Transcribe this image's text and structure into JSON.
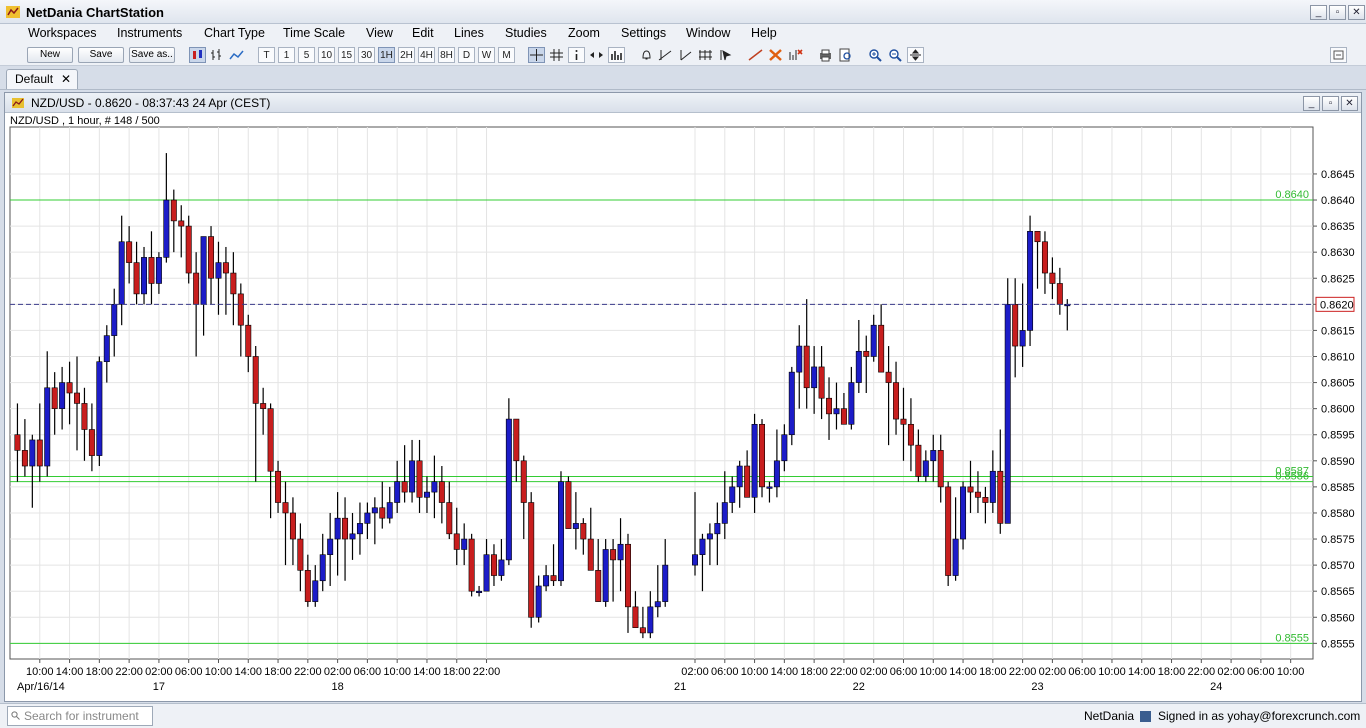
{
  "app": {
    "title": "NetDania ChartStation",
    "window_buttons": [
      "_",
      "▫",
      "✕"
    ]
  },
  "menu": [
    "Workspaces",
    "Instruments",
    "Chart Type",
    "Time Scale",
    "View",
    "Edit",
    "Lines",
    "Studies",
    "Zoom",
    "Settings",
    "Window",
    "Help"
  ],
  "toolbar": {
    "new_label": "New",
    "save_label": "Save",
    "save_as_label": "Save as..",
    "timeframes": [
      "T",
      "1",
      "5",
      "10",
      "15",
      "30",
      "1H",
      "2H",
      "4H",
      "8H",
      "D",
      "W",
      "M"
    ],
    "active_timeframe": "1H"
  },
  "workspace_tab": {
    "label": "Default",
    "close": "✕"
  },
  "chart_window": {
    "title": "NZD/USD - 0.8620 - 08:37:43  24 Apr (CEST)",
    "buttons": [
      "_",
      "▫",
      "✕"
    ]
  },
  "chart_data": {
    "type": "candlestick",
    "title": "NZD/USD , 1 hour, # 148 / 500",
    "ylim": [
      0.8552,
      0.8654
    ],
    "y_ticks": [
      "0.8555",
      "0.8560",
      "0.8565",
      "0.8570",
      "0.8575",
      "0.8580",
      "0.8585",
      "0.8590",
      "0.8595",
      "0.8600",
      "0.8605",
      "0.8610",
      "0.8615",
      "0.8620",
      "0.8625",
      "0.8630",
      "0.8635",
      "0.8640",
      "0.8645"
    ],
    "x_tick_labels": [
      "10:00",
      "14:00",
      "18:00",
      "22:00",
      "02:00",
      "06:00",
      "10:00",
      "14:00",
      "18:00",
      "22:00",
      "02:00",
      "06:00",
      "10:00",
      "14:00",
      "18:00",
      "22:00",
      "02:00",
      "06:00",
      "10:00",
      "14:00",
      "18:00",
      "22:00",
      "02:00",
      "06:00",
      "10:00",
      "14:00",
      "18:00",
      "22:00",
      "02:00",
      "06:00",
      "10:00",
      "14:00",
      "18:00",
      "22:00",
      "02:00",
      "06:00",
      "10:00"
    ],
    "x_tick_hours": [
      10,
      14,
      18,
      22,
      26,
      30,
      34,
      38,
      42,
      46,
      50,
      54,
      58,
      62,
      66,
      70,
      98,
      102,
      106,
      110,
      114,
      118,
      122,
      126,
      130,
      134,
      138,
      142,
      146,
      150,
      154,
      158,
      162,
      166,
      170,
      174,
      178
    ],
    "date_labels": [
      {
        "label": "Apr/16/14",
        "hour": 10
      },
      {
        "label": "17",
        "hour": 26
      },
      {
        "label": "18",
        "hour": 50
      },
      {
        "label": "21",
        "hour": 96
      },
      {
        "label": "22",
        "hour": 120
      },
      {
        "label": "23",
        "hour": 144
      },
      {
        "label": "24",
        "hour": 168
      }
    ],
    "x_range_hours": [
      6,
      181
    ],
    "current_price": 0.862,
    "current_price_label": "0.8620",
    "horizontal_lines": [
      {
        "value": 0.864,
        "label": "0.8640"
      },
      {
        "value": 0.8587,
        "label": "0.8587"
      },
      {
        "value": 0.8586,
        "label": "0.8586"
      },
      {
        "value": 0.8555,
        "label": "0.8555"
      }
    ],
    "colors": {
      "up": "#1c1cc8",
      "down": "#c81e1e",
      "hline": "#33cc33",
      "price_line": "#3a3a8a",
      "price_box": "#cc2020"
    },
    "ohlc": [
      [
        7,
        0.8595,
        0.8601,
        0.8586,
        0.8592
      ],
      [
        8,
        0.8592,
        0.8598,
        0.8587,
        0.8589
      ],
      [
        9,
        0.8589,
        0.8595,
        0.8581,
        0.8594
      ],
      [
        10,
        0.8594,
        0.8601,
        0.8586,
        0.8589
      ],
      [
        11,
        0.8589,
        0.8611,
        0.8587,
        0.8604
      ],
      [
        12,
        0.8604,
        0.8607,
        0.8595,
        0.86
      ],
      [
        13,
        0.86,
        0.8608,
        0.8596,
        0.8605
      ],
      [
        14,
        0.8605,
        0.8609,
        0.8597,
        0.8603
      ],
      [
        15,
        0.8603,
        0.861,
        0.8592,
        0.8601
      ],
      [
        16,
        0.8601,
        0.8604,
        0.859,
        0.8596
      ],
      [
        17,
        0.8596,
        0.8601,
        0.8588,
        0.8591
      ],
      [
        18,
        0.8591,
        0.861,
        0.8589,
        0.8609
      ],
      [
        19,
        0.8609,
        0.8616,
        0.8605,
        0.8614
      ],
      [
        20,
        0.8614,
        0.8623,
        0.861,
        0.862
      ],
      [
        21,
        0.862,
        0.8637,
        0.8616,
        0.8632
      ],
      [
        22,
        0.8632,
        0.8635,
        0.8624,
        0.8628
      ],
      [
        23,
        0.8628,
        0.8632,
        0.862,
        0.8622
      ],
      [
        24,
        0.8622,
        0.8631,
        0.862,
        0.8629
      ],
      [
        25,
        0.8629,
        0.8634,
        0.862,
        0.8624
      ],
      [
        26,
        0.8624,
        0.863,
        0.8622,
        0.8629
      ],
      [
        27,
        0.8629,
        0.8649,
        0.8628,
        0.864
      ],
      [
        28,
        0.864,
        0.8642,
        0.863,
        0.8636
      ],
      [
        29,
        0.8636,
        0.8639,
        0.8629,
        0.8635
      ],
      [
        30,
        0.8635,
        0.8637,
        0.8624,
        0.8626
      ],
      [
        31,
        0.8626,
        0.863,
        0.861,
        0.862
      ],
      [
        32,
        0.862,
        0.8633,
        0.8614,
        0.8633
      ],
      [
        33,
        0.8633,
        0.8635,
        0.862,
        0.8625
      ],
      [
        34,
        0.8625,
        0.8632,
        0.8618,
        0.8628
      ],
      [
        35,
        0.8628,
        0.8631,
        0.8618,
        0.8626
      ],
      [
        36,
        0.8626,
        0.863,
        0.8616,
        0.8622
      ],
      [
        37,
        0.8622,
        0.8624,
        0.861,
        0.8616
      ],
      [
        38,
        0.8616,
        0.8618,
        0.8607,
        0.861
      ],
      [
        39,
        0.861,
        0.8612,
        0.8586,
        0.8601
      ],
      [
        40,
        0.8601,
        0.8604,
        0.8595,
        0.86
      ],
      [
        41,
        0.86,
        0.8601,
        0.8579,
        0.8588
      ],
      [
        42,
        0.8588,
        0.859,
        0.858,
        0.8582
      ],
      [
        43,
        0.8582,
        0.8586,
        0.857,
        0.858
      ],
      [
        44,
        0.858,
        0.8583,
        0.857,
        0.8575
      ],
      [
        45,
        0.8575,
        0.8578,
        0.8565,
        0.8569
      ],
      [
        46,
        0.8569,
        0.8572,
        0.8562,
        0.8563
      ],
      [
        47,
        0.8563,
        0.857,
        0.8562,
        0.8567
      ],
      [
        48,
        0.8567,
        0.8576,
        0.8565,
        0.8572
      ],
      [
        49,
        0.8572,
        0.858,
        0.8566,
        0.8575
      ],
      [
        50,
        0.8575,
        0.8584,
        0.8568,
        0.8579
      ],
      [
        51,
        0.8579,
        0.8583,
        0.8567,
        0.8575
      ],
      [
        52,
        0.8575,
        0.858,
        0.8571,
        0.8576
      ],
      [
        53,
        0.8576,
        0.8582,
        0.8572,
        0.8578
      ],
      [
        54,
        0.8578,
        0.8582,
        0.8575,
        0.858
      ],
      [
        55,
        0.858,
        0.8583,
        0.8574,
        0.8581
      ],
      [
        56,
        0.8581,
        0.8586,
        0.8577,
        0.8579
      ],
      [
        57,
        0.8579,
        0.8585,
        0.8578,
        0.8582
      ],
      [
        58,
        0.8582,
        0.859,
        0.858,
        0.8586
      ],
      [
        59,
        0.8586,
        0.8593,
        0.8582,
        0.8584
      ],
      [
        60,
        0.8584,
        0.8594,
        0.8582,
        0.859
      ],
      [
        61,
        0.859,
        0.8594,
        0.858,
        0.8583
      ],
      [
        62,
        0.8583,
        0.8587,
        0.858,
        0.8584
      ],
      [
        63,
        0.8584,
        0.8591,
        0.8579,
        0.8586
      ],
      [
        64,
        0.8586,
        0.8589,
        0.8578,
        0.8582
      ],
      [
        65,
        0.8582,
        0.8586,
        0.8575,
        0.8576
      ],
      [
        66,
        0.8576,
        0.8581,
        0.857,
        0.8573
      ],
      [
        67,
        0.8573,
        0.8578,
        0.857,
        0.8575
      ],
      [
        68,
        0.8575,
        0.8576,
        0.8564,
        0.8565
      ],
      [
        69,
        0.8565,
        0.8566,
        0.8564,
        0.8565
      ],
      [
        70,
        0.8565,
        0.8575,
        0.8568,
        0.8572
      ],
      [
        71,
        0.8572,
        0.8574,
        0.8566,
        0.8568
      ],
      [
        72,
        0.8568,
        0.8575,
        0.8567,
        0.8571
      ],
      [
        73,
        0.8571,
        0.8602,
        0.857,
        0.8598
      ],
      [
        74,
        0.8598,
        0.8598,
        0.8586,
        0.859
      ],
      [
        75,
        0.859,
        0.8591,
        0.8575,
        0.8582
      ],
      [
        76,
        0.8582,
        0.8584,
        0.8558,
        0.856
      ],
      [
        77,
        0.856,
        0.8568,
        0.8559,
        0.8566
      ],
      [
        78,
        0.8566,
        0.857,
        0.8565,
        0.8568
      ],
      [
        79,
        0.8568,
        0.8574,
        0.8566,
        0.8567
      ],
      [
        80,
        0.8567,
        0.8588,
        0.8566,
        0.8586
      ],
      [
        81,
        0.8586,
        0.8587,
        0.8577,
        0.8577
      ],
      [
        82,
        0.8577,
        0.8584,
        0.8573,
        0.8578
      ],
      [
        83,
        0.8578,
        0.8579,
        0.8572,
        0.8575
      ],
      [
        84,
        0.8575,
        0.8581,
        0.857,
        0.8569
      ],
      [
        85,
        0.8569,
        0.8575,
        0.8563,
        0.8563
      ],
      [
        86,
        0.8563,
        0.8575,
        0.8562,
        0.8573
      ],
      [
        87,
        0.8573,
        0.8575,
        0.8563,
        0.8571
      ],
      [
        88,
        0.8571,
        0.8579,
        0.8565,
        0.8574
      ],
      [
        89,
        0.8574,
        0.8576,
        0.8557,
        0.8562
      ],
      [
        90,
        0.8562,
        0.8565,
        0.8558,
        0.8558
      ],
      [
        91,
        0.8558,
        0.8562,
        0.8556,
        0.8557
      ],
      [
        92,
        0.8557,
        0.8565,
        0.8556,
        0.8562
      ],
      [
        93,
        0.8562,
        0.857,
        0.856,
        0.8563
      ],
      [
        94,
        0.8563,
        0.8575,
        0.8562,
        0.857
      ]
    ],
    "ohlc2": [
      [
        98,
        0.857,
        0.8584,
        0.8568,
        0.8572
      ],
      [
        99,
        0.8572,
        0.8576,
        0.8565,
        0.8575
      ],
      [
        100,
        0.8575,
        0.8578,
        0.857,
        0.8576
      ],
      [
        101,
        0.8576,
        0.8582,
        0.857,
        0.8578
      ],
      [
        102,
        0.8578,
        0.8588,
        0.8575,
        0.8582
      ],
      [
        103,
        0.8582,
        0.8587,
        0.858,
        0.8585
      ],
      [
        104,
        0.8585,
        0.859,
        0.8581,
        0.8589
      ],
      [
        105,
        0.8589,
        0.8592,
        0.8583,
        0.8583
      ],
      [
        106,
        0.8583,
        0.8599,
        0.858,
        0.8597
      ],
      [
        107,
        0.8597,
        0.8598,
        0.8583,
        0.8585
      ],
      [
        108,
        0.8585,
        0.8586,
        0.8582,
        0.8585
      ],
      [
        109,
        0.8585,
        0.8596,
        0.8583,
        0.859
      ],
      [
        110,
        0.859,
        0.8597,
        0.8588,
        0.8595
      ],
      [
        111,
        0.8595,
        0.8608,
        0.8593,
        0.8607
      ],
      [
        112,
        0.8607,
        0.8616,
        0.86,
        0.8612
      ],
      [
        113,
        0.8612,
        0.8621,
        0.86,
        0.8604
      ],
      [
        114,
        0.8604,
        0.8612,
        0.8599,
        0.8608
      ],
      [
        115,
        0.8608,
        0.8612,
        0.8598,
        0.8602
      ],
      [
        116,
        0.8602,
        0.8606,
        0.8594,
        0.8599
      ],
      [
        117,
        0.8599,
        0.8605,
        0.8596,
        0.86
      ],
      [
        118,
        0.86,
        0.8603,
        0.8597,
        0.8597
      ],
      [
        119,
        0.8597,
        0.8608,
        0.8596,
        0.8605
      ],
      [
        120,
        0.8605,
        0.8617,
        0.8603,
        0.8611
      ],
      [
        121,
        0.8611,
        0.8614,
        0.8603,
        0.861
      ],
      [
        122,
        0.861,
        0.8618,
        0.8609,
        0.8616
      ],
      [
        123,
        0.8616,
        0.862,
        0.8607,
        0.8607
      ],
      [
        124,
        0.8607,
        0.8612,
        0.8593,
        0.8605
      ],
      [
        125,
        0.8605,
        0.8609,
        0.8595,
        0.8598
      ],
      [
        126,
        0.8598,
        0.8604,
        0.859,
        0.8597
      ],
      [
        127,
        0.8597,
        0.8602,
        0.8588,
        0.8593
      ],
      [
        128,
        0.8593,
        0.8596,
        0.8586,
        0.8587
      ],
      [
        129,
        0.8587,
        0.8592,
        0.8586,
        0.859
      ],
      [
        130,
        0.859,
        0.8595,
        0.8586,
        0.8592
      ],
      [
        131,
        0.8592,
        0.8595,
        0.8582,
        0.8585
      ],
      [
        132,
        0.8585,
        0.8586,
        0.8566,
        0.8568
      ],
      [
        133,
        0.8568,
        0.8583,
        0.8567,
        0.8575
      ],
      [
        134,
        0.8575,
        0.8586,
        0.8573,
        0.8585
      ],
      [
        135,
        0.8585,
        0.859,
        0.858,
        0.8584
      ],
      [
        136,
        0.8584,
        0.8588,
        0.858,
        0.8583
      ],
      [
        137,
        0.8583,
        0.8585,
        0.8578,
        0.8582
      ],
      [
        138,
        0.8582,
        0.8592,
        0.858,
        0.8588
      ],
      [
        139,
        0.8588,
        0.8596,
        0.8576,
        0.8578
      ],
      [
        140,
        0.8578,
        0.8625,
        0.858,
        0.862
      ],
      [
        141,
        0.862,
        0.8625,
        0.8606,
        0.8612
      ],
      [
        142,
        0.8612,
        0.8624,
        0.8608,
        0.8615
      ],
      [
        143,
        0.8615,
        0.8637,
        0.8612,
        0.8634
      ],
      [
        144,
        0.8634,
        0.8634,
        0.8623,
        0.8632
      ],
      [
        145,
        0.8632,
        0.8634,
        0.8622,
        0.8626
      ],
      [
        146,
        0.8626,
        0.8629,
        0.8621,
        0.8624
      ],
      [
        147,
        0.8624,
        0.8627,
        0.8618,
        0.862
      ],
      [
        148,
        0.862,
        0.8621,
        0.8615,
        0.862
      ]
    ]
  },
  "status": {
    "search_placeholder": "Search for instrument",
    "brand": "NetDania",
    "signed_in": "Signed in as yohay@forexcrunch.com"
  }
}
